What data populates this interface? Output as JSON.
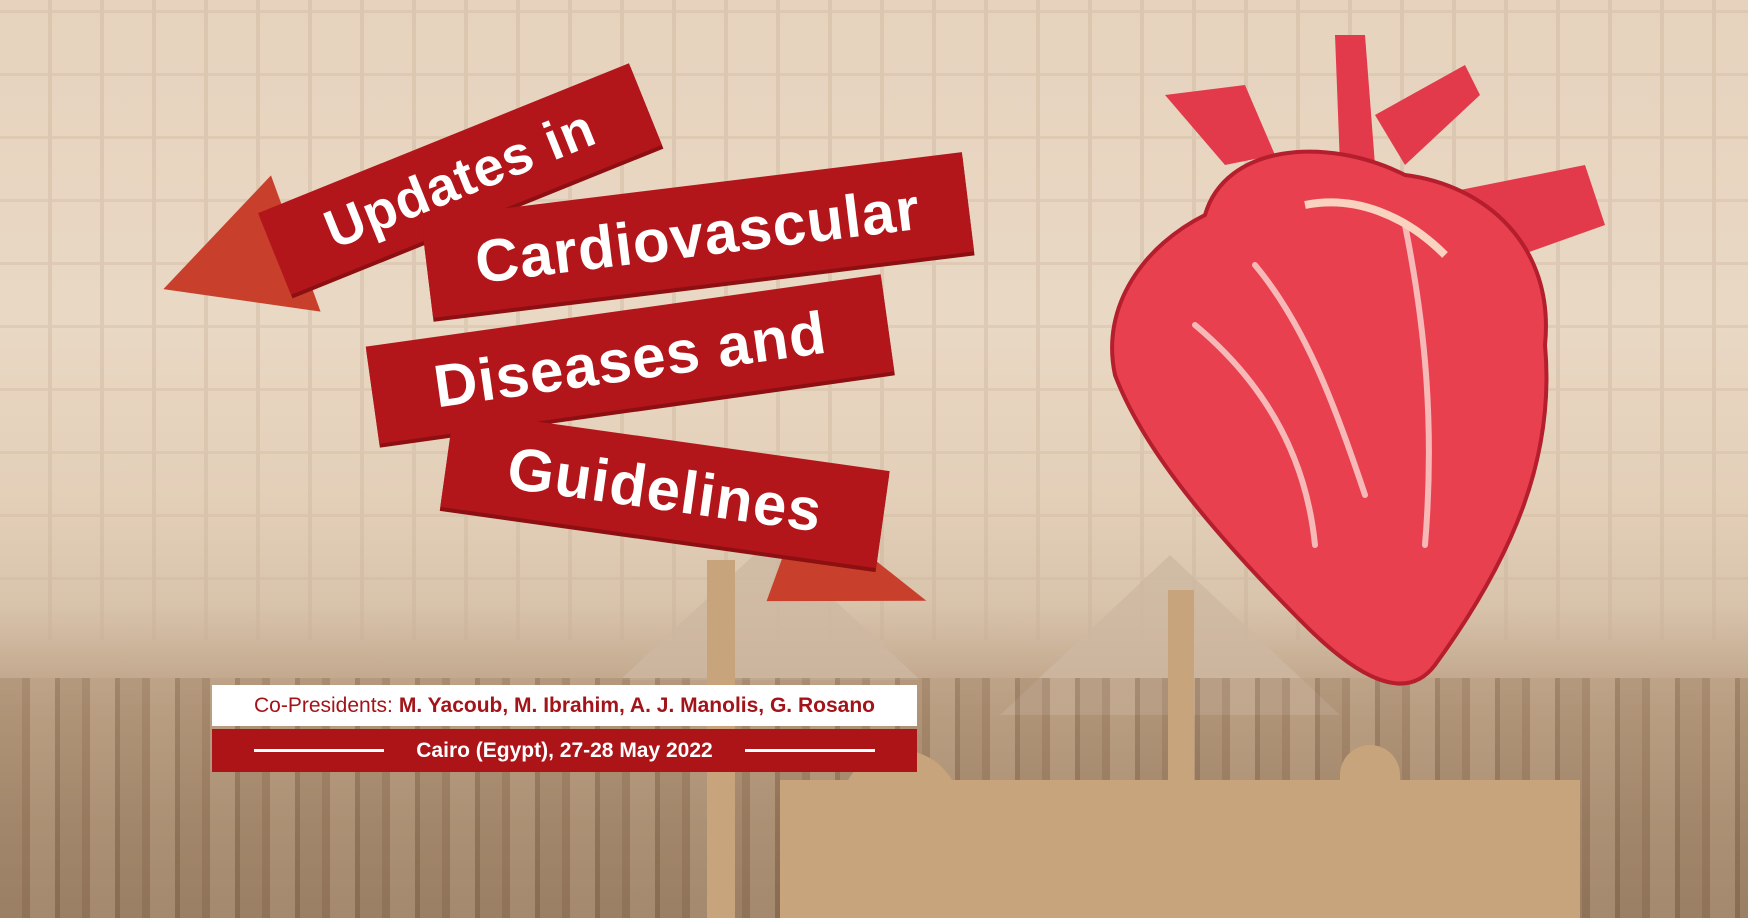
{
  "title": {
    "line1": "Updates in",
    "line2": "Cardiovascular",
    "line3": "Diseases and",
    "line4": "Guidelines"
  },
  "co_presidents": {
    "label": "Co-Presidents:",
    "names": "M. Yacoub, M. Ibrahim, A. J. Manolis, G. Rosano"
  },
  "event": {
    "location_date": "Cairo (Egypt), 27-28 May 2022"
  },
  "colors": {
    "ribbon": "#b3161a",
    "heart": "#e8404e"
  }
}
